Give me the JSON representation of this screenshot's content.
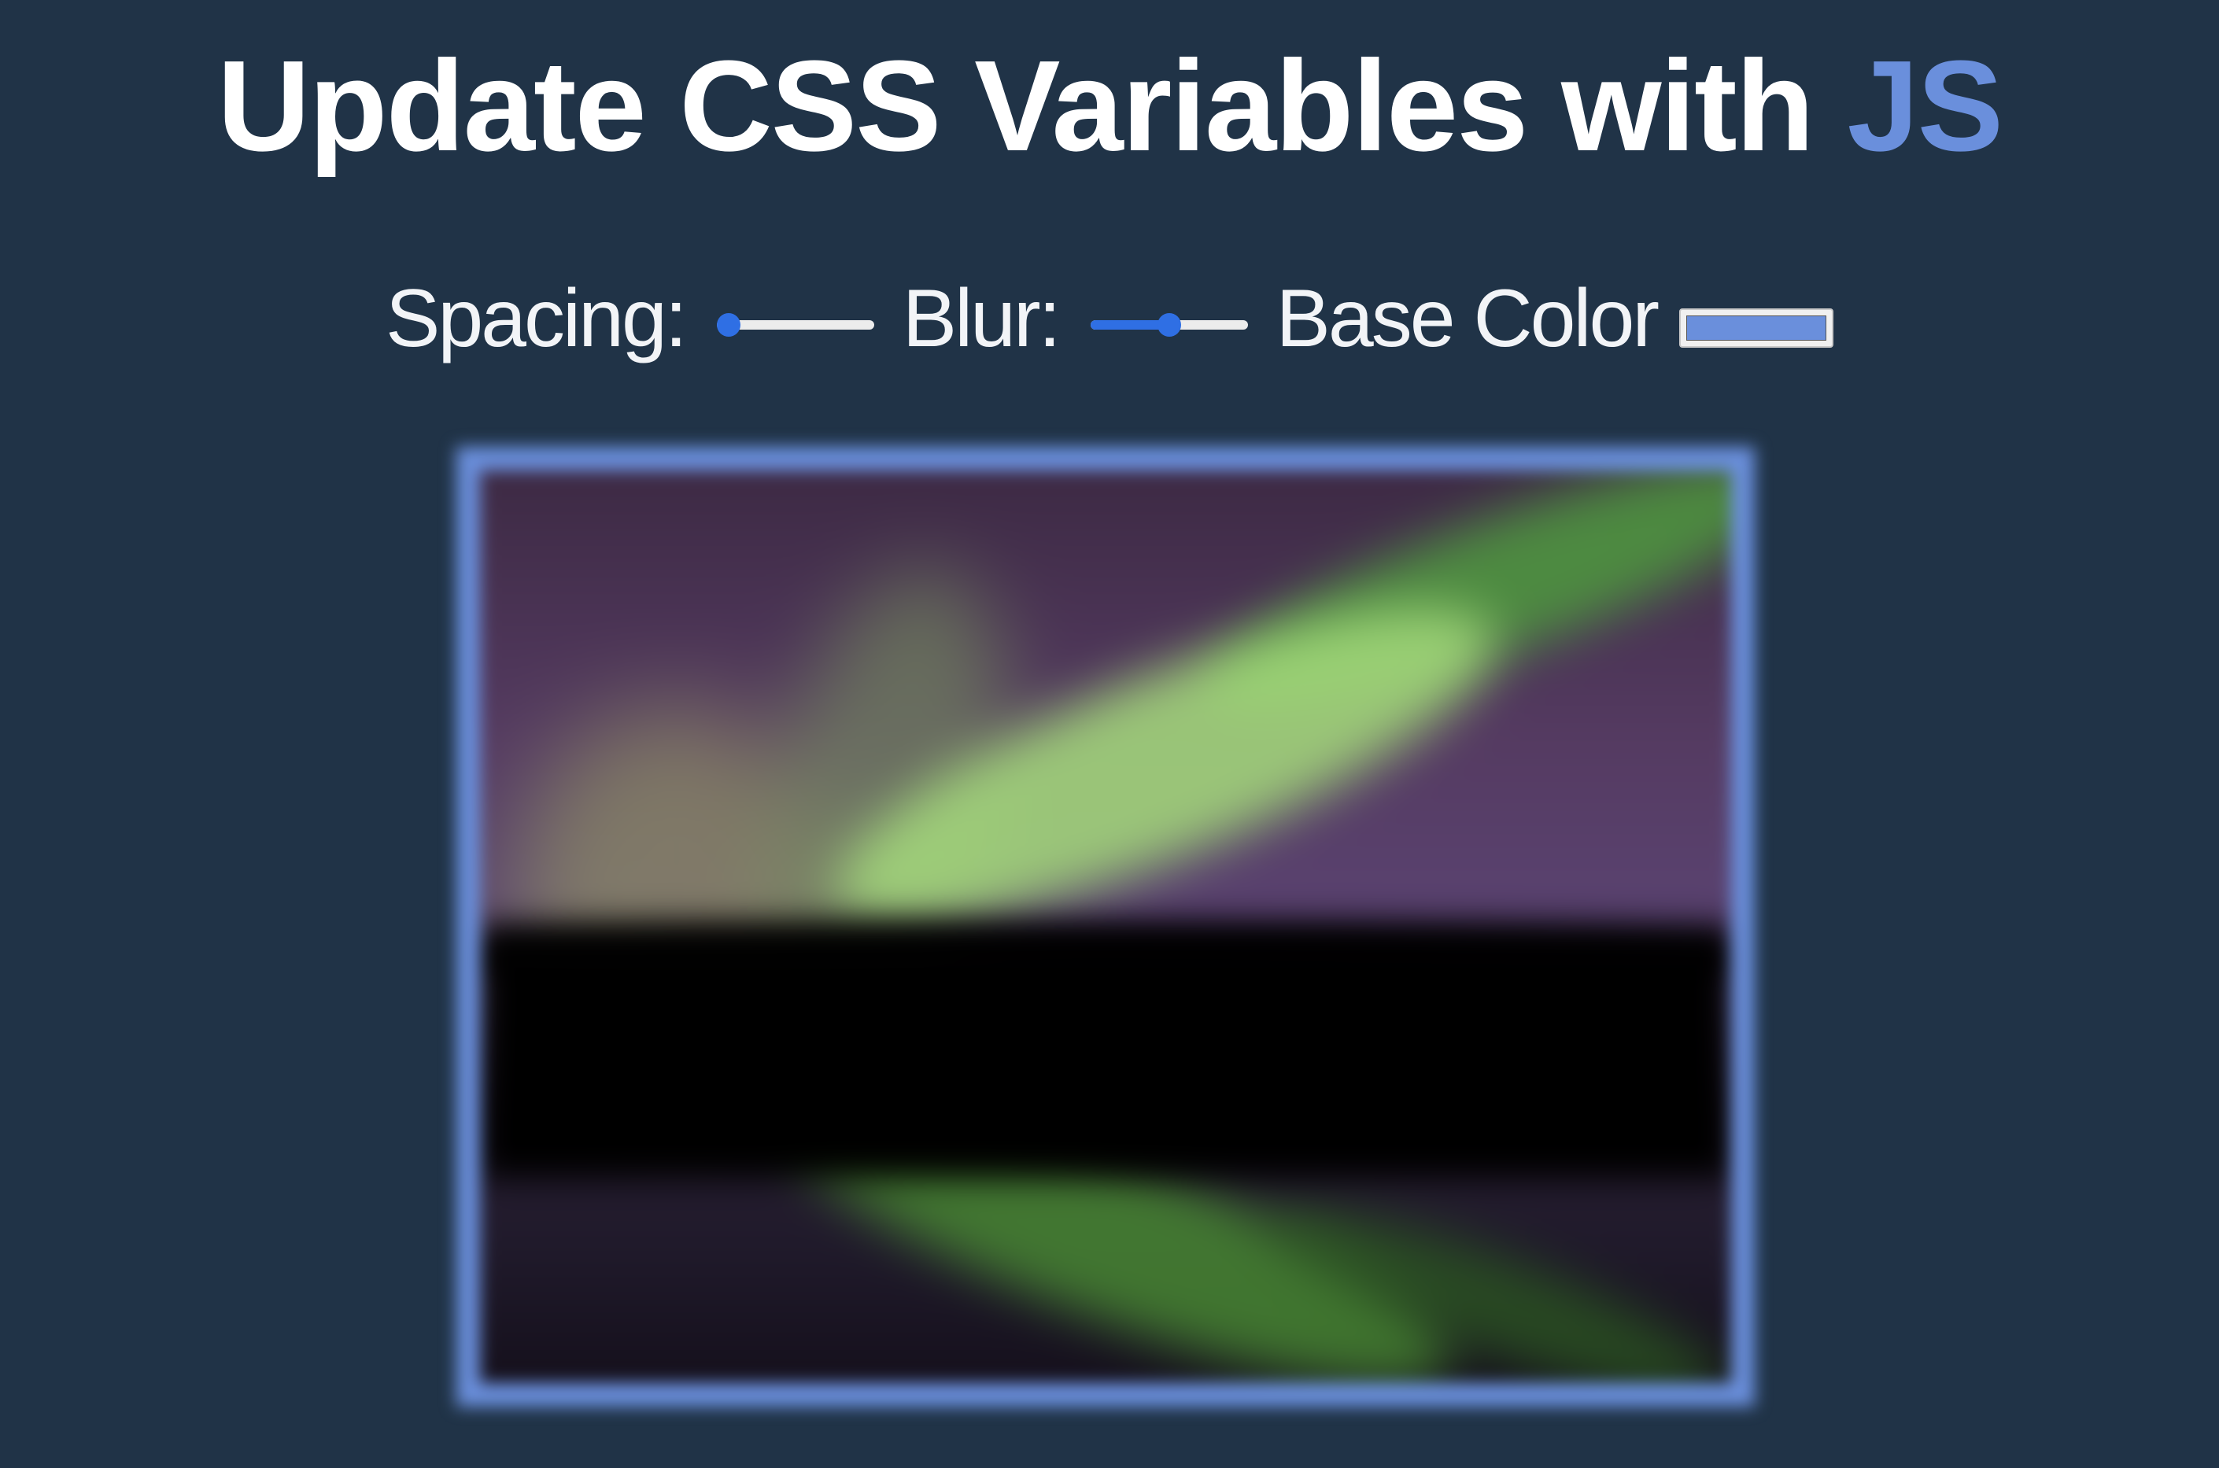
{
  "header": {
    "title_main": "Update CSS Variables with ",
    "title_highlight": "JS"
  },
  "controls": {
    "spacing": {
      "label": "Spacing:",
      "value_fraction": 0.0
    },
    "blur": {
      "label": "Blur:",
      "value_fraction": 0.5
    },
    "base_color": {
      "label": "Base Color",
      "value": "#6a8fdc"
    }
  },
  "image": {
    "icon": "aurora-photo"
  },
  "colors": {
    "background": "#203347",
    "accent": "#6a8fdc",
    "slider": "#2f6fe4"
  }
}
